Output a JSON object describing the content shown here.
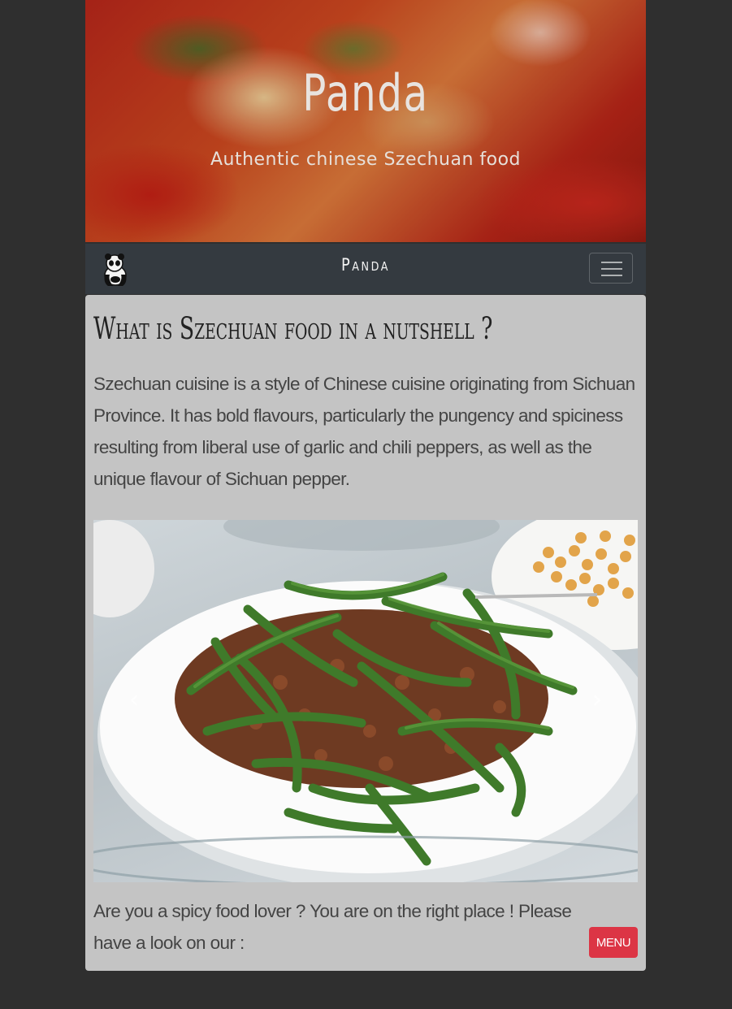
{
  "hero": {
    "title": "Panda",
    "subtitle": "Authentic chinese Szechuan food"
  },
  "navbar": {
    "logo_icon": "panda-logo-icon",
    "brand": "Panda",
    "toggler_icon": "hamburger-menu-icon"
  },
  "section": {
    "title": "What is Szechuan food in a nutshell ?",
    "text": "Szechuan cuisine is a style of Chinese cuisine originating from Sichuan Province. It has bold flavours, particularly the pungency and spiciness resulting from liberal use of garlic and chili peppers, as well as the unique flavour of Sichuan pepper."
  },
  "carousel": {
    "prev_icon": "chevron-left-icon",
    "next_icon": "chevron-right-icon",
    "prev_glyph": "‹",
    "next_glyph": "›"
  },
  "footer": {
    "text": "Are you a spicy food lover ? You are on the right place ! Please have a look on our :",
    "menu_button": "MENU"
  },
  "colors": {
    "background": "#2f2f2f",
    "navbar": "#343a40",
    "card": "#c4c4c4",
    "menu_button": "#dc3545"
  }
}
